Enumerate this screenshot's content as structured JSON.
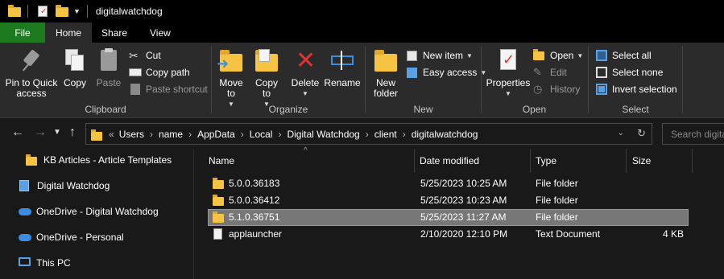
{
  "window": {
    "title": "digitalwatchdog"
  },
  "tabs": [
    "File",
    "Home",
    "Share",
    "View"
  ],
  "ribbon": {
    "clipboard": {
      "label": "Clipboard",
      "pin": "Pin to Quick access",
      "copy": "Copy",
      "paste": "Paste",
      "cut": "Cut",
      "copy_path": "Copy path",
      "paste_shortcut": "Paste shortcut"
    },
    "organize": {
      "label": "Organize",
      "move_to": "Move to",
      "copy_to": "Copy to",
      "delete": "Delete",
      "rename": "Rename"
    },
    "new": {
      "label": "New",
      "new_folder": "New folder",
      "new_item": "New item",
      "easy_access": "Easy access"
    },
    "open": {
      "label": "Open",
      "properties": "Properties",
      "open": "Open",
      "edit": "Edit",
      "history": "History"
    },
    "select": {
      "label": "Select",
      "select_all": "Select all",
      "select_none": "Select none",
      "invert_selection": "Invert selection"
    }
  },
  "address": {
    "overflow": "«",
    "crumbs": [
      "Users",
      "name",
      "AppData",
      "Local",
      "Digital Watchdog",
      "client",
      "digitalwatchdog"
    ],
    "search_placeholder": "Search digitalwatchdog"
  },
  "navpane": {
    "items": [
      {
        "label": "KB Articles - Article Templates",
        "icon": "folder-icon"
      },
      {
        "label": "Digital Watchdog",
        "icon": "dw-icon"
      },
      {
        "label": "OneDrive - Digital Watchdog",
        "icon": "cloud-icon"
      },
      {
        "label": "OneDrive - Personal",
        "icon": "cloud-icon"
      },
      {
        "label": "This PC",
        "icon": "pc-icon"
      }
    ]
  },
  "filelist": {
    "columns": [
      "Name",
      "Date modified",
      "Type",
      "Size"
    ],
    "rows": [
      {
        "name": "5.0.0.36183",
        "date": "5/25/2023 10:25 AM",
        "type": "File folder",
        "size": "",
        "icon": "folder-icon",
        "selected": false
      },
      {
        "name": "5.0.0.36412",
        "date": "5/25/2023 10:23 AM",
        "type": "File folder",
        "size": "",
        "icon": "folder-icon",
        "selected": false
      },
      {
        "name": "5.1.0.36751",
        "date": "5/25/2023 11:27 AM",
        "type": "File folder",
        "size": "",
        "icon": "folder-icon",
        "selected": true
      },
      {
        "name": "applauncher",
        "date": "2/10/2020 12:10 PM",
        "type": "Text Document",
        "size": "4 KB",
        "icon": "text-file-icon",
        "selected": false
      }
    ]
  },
  "colors": {
    "file_tab": "#1d7a1f",
    "ribbon_bg": "#2b2b2b",
    "window_bg": "#191919",
    "selected_row": "#777777",
    "folder": "#f6c343",
    "accent_blue": "#3a8fe0"
  }
}
